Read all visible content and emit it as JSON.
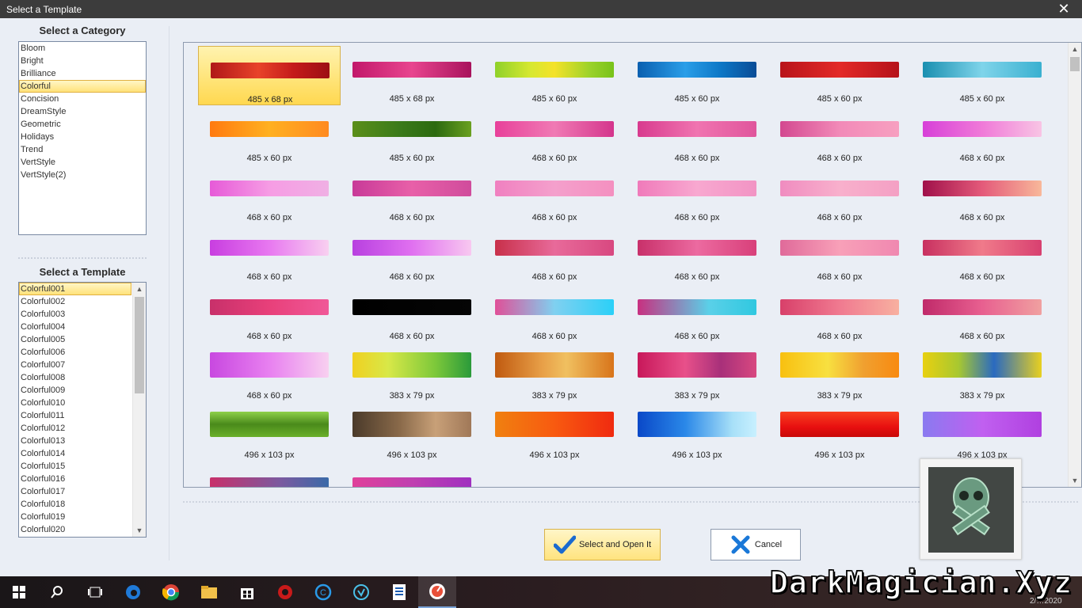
{
  "window": {
    "title": "Select a Template",
    "close_glyph": "✕"
  },
  "category": {
    "heading": "Select a Category",
    "items": [
      "Bloom",
      "Bright",
      "Brilliance",
      "Colorful",
      "Concision",
      "DreamStyle",
      "Geometric",
      "Holidays",
      "Trend",
      "VertStyle",
      "VertStyle(2)"
    ],
    "selected": "Colorful"
  },
  "templates": {
    "heading": "Select a Template",
    "items": [
      "Colorful001",
      "Colorful002",
      "Colorful003",
      "Colorful004",
      "Colorful005",
      "Colorful006",
      "Colorful007",
      "Colorful008",
      "Colorful009",
      "Colorful010",
      "Colorful011",
      "Colorful012",
      "Colorful013",
      "Colorful014",
      "Colorful015",
      "Colorful016",
      "Colorful017",
      "Colorful018",
      "Colorful019",
      "Colorful020"
    ],
    "selected": "Colorful001"
  },
  "grid": {
    "rows": [
      [
        "485 x 68 px",
        "485 x 68 px",
        "485 x 60 px",
        "485 x 60 px",
        "485 x 60 px",
        "485 x 60 px"
      ],
      [
        "485 x 60 px",
        "485 x 60 px",
        "468 x 60 px",
        "468 x 60 px",
        "468 x 60 px",
        "468 x 60 px"
      ],
      [
        "468 x 60 px",
        "468 x 60 px",
        "468 x 60 px",
        "468 x 60 px",
        "468 x 60 px",
        "468 x 60 px"
      ],
      [
        "468 x 60 px",
        "468 x 60 px",
        "468 x 60 px",
        "468 x 60 px",
        "468 x 60 px",
        "468 x 60 px"
      ],
      [
        "468 x 60 px",
        "468 x 60 px",
        "468 x 60 px",
        "468 x 60 px",
        "468 x 60 px",
        "468 x 60 px"
      ],
      [
        "468 x 60 px",
        "383 x 79 px",
        "383 x 79 px",
        "383 x 79 px",
        "383 x 79 px",
        "383 x 79 px"
      ],
      [
        "496 x 103 px",
        "496 x 103 px",
        "496 x 103 px",
        "496 x 103 px",
        "496 x 103 px",
        "496 x 103 px"
      ]
    ],
    "banner_styles": [
      [
        "linear-gradient(90deg,#b01818,#e8432a 40%,#c41a1a 70%,#9c0f14)",
        "linear-gradient(90deg,#c2186a,#e8458f 50%,#a8125c)",
        "linear-gradient(90deg,#8fd12a,#d7e830 30%,#f4e22a 50%,#9bd22a 80%,#78c21a)",
        "linear-gradient(90deg,#0a5fb0,#2a9ee8 40%,#0d77c6 70%,#0a4c96)",
        "linear-gradient(90deg,#b8141a,#e32a28 50%,#b5121a)",
        "linear-gradient(90deg,#1a8fb0,#7fd4ea 50%,#3ab0d0)"
      ],
      [
        "linear-gradient(90deg,#ff7a10,#ffb020 50%,#ff8a20)",
        "linear-gradient(90deg,#5b8f1a,#3a7a1a 40%,#2c6a10 70%,#6aa020)",
        "linear-gradient(90deg,#e8409a,#f07ab4 50%,#d4358c)",
        "linear-gradient(90deg,#d83a8e,#f074b0 50%,#e0559c)",
        "linear-gradient(90deg,#d34890,#f28ab8 50%,#f7a0c0)",
        "linear-gradient(90deg,#d740d8,#f07ad8 50%,#f8c4e4)"
      ],
      [
        "linear-gradient(90deg,#e65ad8,#f69ce4 50%,#f0b0e4)",
        "linear-gradient(90deg,#c83a98,#e860a8 50%,#d04c9c)",
        "linear-gradient(90deg,#f080c0,#f4a0cc 50%,#f490c0)",
        "linear-gradient(90deg,#f07aba,#f8a8d0 50%,#f294c4)",
        "linear-gradient(90deg,#f08cc0,#f8b0cc 50%,#f4a0c4)",
        "linear-gradient(90deg,#a0104a,#e45a7a 50%,#f8b89a)"
      ],
      [
        "linear-gradient(90deg,#c83ee0,#e878f0 50%,#f8d0f0)",
        "linear-gradient(90deg,#b840e0,#e070f0 50%,#f8c8f0)",
        "linear-gradient(90deg,#c8304a,#e86a9a 50%,#d84880)",
        "linear-gradient(90deg,#c8306a,#ec6aa0 50%,#d8407a)",
        "linear-gradient(90deg,#e06a9a,#f8a0b8 50%,#f088b0)",
        "linear-gradient(90deg,#c83060,#f07a8a 50%,#d84070)"
      ],
      [
        "linear-gradient(90deg,#c8306a,#e8407a 50%,#f05898)",
        "linear-gradient(90deg,#000000,#050505)",
        "linear-gradient(90deg,#e05098,#80d0f0 50%,#2ad0f8)",
        "linear-gradient(90deg,#c83080,#5ad0e8 60%,#30c8e0)",
        "linear-gradient(90deg,#d8406a,#f07a90 50%,#f8b0a0)",
        "linear-gradient(90deg,#c02a6a,#e86090 50%,#f0a0a0)"
      ],
      [
        "linear-gradient(90deg,#c848e0,#e880f0 50%,#f8d0f0)",
        "linear-gradient(90deg,#f0d020,#d8e848 30%,#7cc83a 70%,#2a9a3a)",
        "linear-gradient(90deg,#c05a10,#e8a048 40%,#f0c060 60%,#d8741a)",
        "linear-gradient(90deg,#c8185a,#e8508a 40%,#a8307a 70%,#d84880)",
        "linear-gradient(90deg,#f8c010,#f8e040 40%,#f0a030 70%,#f88a10)",
        "linear-gradient(90deg,#e8d010,#a8c830 30%,#2a6ac0 60%,#e8d020)"
      ],
      [
        "linear-gradient(#8ed04a,#4a8a1a 50%,#6ab02a)",
        "linear-gradient(90deg,#4a3a2a,#8a6a4a 40%,#c8a078 70%,#a07858)",
        "linear-gradient(90deg,#f08010,#f85a10 50%,#f02a10)",
        "linear-gradient(90deg,#0a48c8,#2a88e8 40%,#a8e0f8 80%,#c8f0ff)",
        "linear-gradient(#f84020,#e81010 60%,#c80808)",
        "linear-gradient(90deg,#8a7af0,#c060f0 50%,#b040e0)"
      ]
    ],
    "partial_row_styles": [
      "linear-gradient(90deg,#c8306a,#7a5aa0 60%,#3a6aa8)",
      "linear-gradient(90deg,#e0409a,#c040b0 50%,#a030c0)"
    ],
    "selected_index": 0
  },
  "buttons": {
    "ok_label": "Select and Open It",
    "cancel_label": "Cancel"
  },
  "taskbar": {
    "icons": [
      "windows-start-icon",
      "search-icon",
      "task-view-icon",
      "edge-icon",
      "chrome-icon",
      "file-explorer-icon",
      "store-icon",
      "app-icon",
      "ccleaner-icon",
      "app-icon-2",
      "notepad-icon",
      "banner-maker-icon"
    ],
    "clock": "2/…2020"
  },
  "watermark": "DarkMagician.Xyz"
}
